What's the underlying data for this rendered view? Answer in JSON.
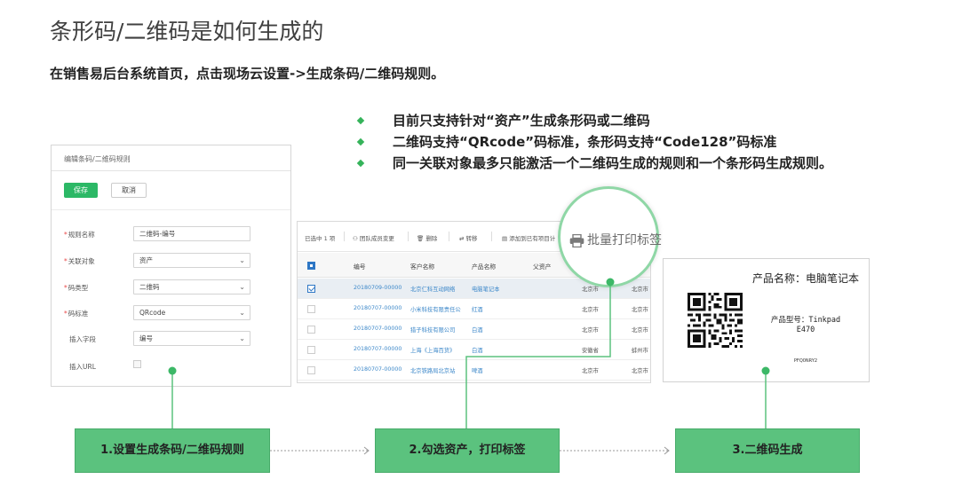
{
  "slide": {
    "title": "条形码/二维码是如何生成的",
    "intro": "在销售易后台系统首页，点击现场云设置->生成条码/二维码规则。",
    "bullets": [
      "目前只支持针对“资产”生成条形码或二维码",
      "二维码支持“QRcode”码标准，条形码支持“Code128”码标准",
      "同一关联对象最多只能激活一个二维码生成的规则和一个条形码生成规则。"
    ]
  },
  "form": {
    "title": "编辑条码/二维码规则",
    "save_label": "保存",
    "cancel_label": "取消",
    "fields": [
      {
        "label": "规则名称",
        "required": "*",
        "value": "二维码-编号"
      },
      {
        "label": "关联对象",
        "required": "*",
        "value": "资产"
      },
      {
        "label": "码类型",
        "required": "*",
        "value": "二维码"
      },
      {
        "label": "码标准",
        "required": "*",
        "value": "QRcode"
      },
      {
        "label": "插入字段",
        "required": "",
        "value": "编号"
      },
      {
        "label": "插入URL",
        "required": "",
        "value": ""
      }
    ]
  },
  "table": {
    "toolbar": {
      "selected": "已选中 1 项",
      "team": "团队成员变更",
      "delete": "删除",
      "transfer": "转移",
      "add": "添加到已有项目计"
    },
    "columns": [
      "编号",
      "客户名称",
      "产品名称",
      "父资产"
    ],
    "rows": [
      {
        "id": "20180709-00000",
        "customer": "北京仁科互动网络",
        "product": "电脑笔记本",
        "city1": "北京市",
        "city2": "北京市",
        "checked": true
      },
      {
        "id": "20180707-00000",
        "customer": "小米科技有限责任公",
        "product": "红酒",
        "city1": "北京市",
        "city2": "北京市",
        "checked": false
      },
      {
        "id": "20180707-00000",
        "customer": "猎子科技有限公司",
        "product": "白酒",
        "city1": "北京市",
        "city2": "北京市",
        "checked": false
      },
      {
        "id": "20180707-00000",
        "customer": "上海《上海百货》",
        "product": "白酒",
        "city1": "安徽省",
        "city2": "蚌州市",
        "checked": false
      },
      {
        "id": "20180707-00000",
        "customer": "北京铁路局北京站",
        "product": "啤酒",
        "city1": "北京市",
        "city2": "北京市",
        "checked": false
      }
    ],
    "print_button": "批量打印标签"
  },
  "label": {
    "name": "产品名称：电脑笔记本",
    "model_line1": "产品型号：Tinkpad",
    "model_line2": "E470",
    "code": "PFQ0NRY2"
  },
  "steps": [
    {
      "label": "1.设置生成条码/二维码规则"
    },
    {
      "label": "2.勾选资产，打印标签"
    },
    {
      "label": "3.二维码生成"
    }
  ],
  "colors": {
    "accent": "#5bc27e",
    "save": "#2cb866",
    "link": "#3b87c9"
  }
}
